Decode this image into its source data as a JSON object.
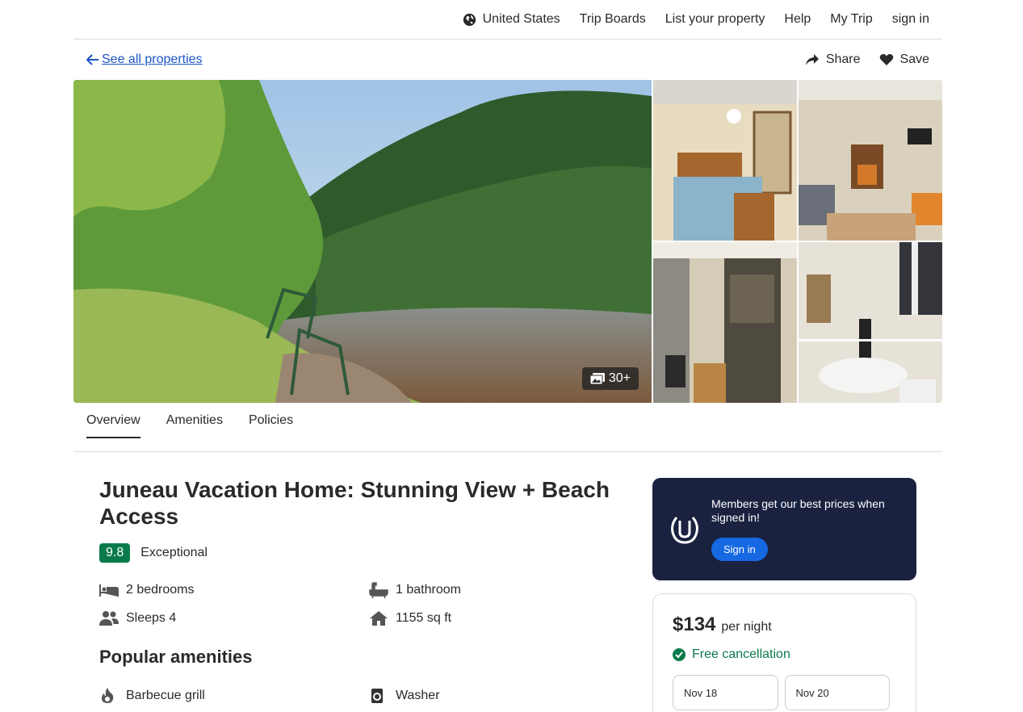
{
  "topnav": {
    "items": [
      "United States",
      "Trip Boards",
      "List your property",
      "Help",
      "My Trip",
      "sign in"
    ]
  },
  "subbar": {
    "back_label": "See all properties",
    "share_label": "Share",
    "save_label": "Save"
  },
  "gallery": {
    "photo_count": "30+"
  },
  "tabs": [
    "Overview",
    "Amenities",
    "Policies"
  ],
  "property": {
    "title": "Juneau Vacation Home: Stunning View + Beach Access",
    "rating_score": "9.8",
    "rating_label": "Exceptional",
    "facts": {
      "bedrooms": "2 bedrooms",
      "bathrooms": "1 bathroom",
      "sleeps": "Sleeps 4",
      "area": "1155 sq ft"
    },
    "amenities_title": "Popular amenities",
    "amenities": [
      "Barbecue grill",
      "Washer"
    ]
  },
  "promo": {
    "text": "Members get our best prices when signed in!",
    "button": "Sign in"
  },
  "booking": {
    "price": "$134",
    "price_unit": "per night",
    "cancellation": "Free cancellation",
    "check_in": "Nov 18",
    "check_out": "Nov 20"
  },
  "colors": {
    "link": "#1b55c5",
    "rating_green": "#0b7a4b",
    "promo_bg": "#1a2240",
    "button_blue": "#1668e3"
  }
}
